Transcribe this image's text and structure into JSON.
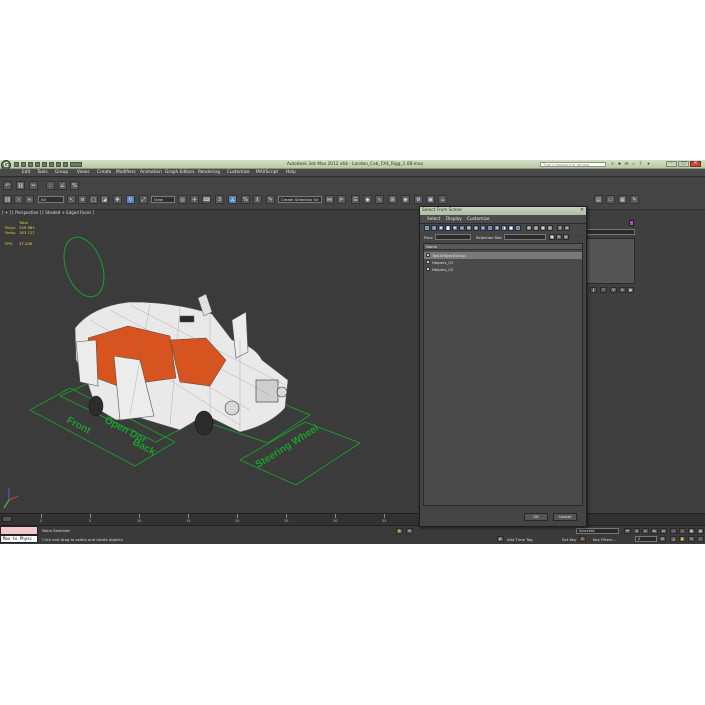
{
  "app": {
    "logo_glyph": "G",
    "title": "Autodesk 3ds Max  2012 x64   -   London_Cab_FX4_Rigg_1.0B.max",
    "search_placeholder": "Type a keyword or phrase"
  },
  "menu": [
    "Edit",
    "Tools",
    "Group",
    "Views",
    "Create",
    "Modifiers",
    "Animation",
    "Graph Editors",
    "Rendering",
    "Customize",
    "MAXScript",
    "Help"
  ],
  "toolbar": {
    "selection_filter": "All",
    "view_dropdown": "View",
    "named_selection": "Create Selection Se"
  },
  "viewport": {
    "label": "[ + ] [ Perspective ] [ Shaded + Edged Faces ]",
    "stats": {
      "header": "Total",
      "polys_label": "Polys:",
      "polys_value": "349 983",
      "verts_label": "Verts:",
      "verts_value": "183 127",
      "fps_label": "FPS:",
      "fps_value": "37.206"
    },
    "controls": {
      "front": "Front",
      "open_dor": "Open Dor",
      "back": "Back",
      "steering": "Steering Wheel"
    },
    "colors": {
      "wire": "#f0f0f0",
      "interior": "#d9531e",
      "helper": "#1d9e2a"
    }
  },
  "dialog": {
    "title": "Select From Scene",
    "close_glyph": "✕",
    "menu": [
      "Select",
      "Display",
      "Customize"
    ],
    "find_label": "Find:",
    "selection_set_label": "Selection Set:",
    "column_name": "Name",
    "rows": [
      "Taxi4ObjectGroup",
      "Helpers_01",
      "Helpers_02"
    ],
    "ok_label": "OK",
    "cancel_label": "Cancel"
  },
  "trackbar": {
    "ticks": [
      "0",
      "5",
      "10",
      "15",
      "20",
      "25",
      "30",
      "35"
    ]
  },
  "status": {
    "listener_text": "Max to Physc",
    "selection": "None Selected",
    "prompt": "Click and drag to select and rotate objects",
    "add_time_tag": "Add Time Tag",
    "set_key": "Set Key",
    "key_filters": "Key Filters...",
    "auto_key_value": "Selected",
    "frame_value": "0"
  }
}
